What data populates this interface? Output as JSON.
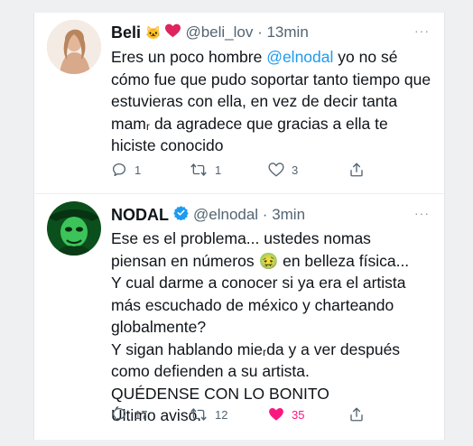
{
  "tweets": [
    {
      "name": "Beli",
      "badges": [
        "🐱",
        "❤️"
      ],
      "handle_time": "@beli_lov · 13min",
      "more": "···",
      "body_before": "Eres un poco hombre ",
      "mention": "@elnodal",
      "body_after": " yo no sé cómo fue que pudo soportar tanto tiempo que estuvieras con ella, en vez de decir tanta mamᵣ da agradece que gracias a ella te hiciste conocido",
      "replies": "1",
      "retweets": "1",
      "likes": "3",
      "liked": false
    },
    {
      "name": "NODAL",
      "verified": true,
      "handle_time": "@elnodal · 3min",
      "more": "···",
      "lines": [
        "Ese es el problema... ustedes nomas",
        "piensan en números 🤢 en belleza física...",
        "Y cual darme a conocer si ya era el artista",
        "más escuchado de méxico y charteando",
        "globalmente?",
        "Y sigan hablando mieᵣda y a ver después",
        "como defienden a su artista.",
        "QUÉDENSE CON LO BONITO",
        "Último aviso."
      ],
      "replies": "17",
      "retweets": "12",
      "likes": "35",
      "liked": true,
      "colors": {
        "like": "#f91880",
        "verified": "#1d9bf0"
      }
    }
  ]
}
